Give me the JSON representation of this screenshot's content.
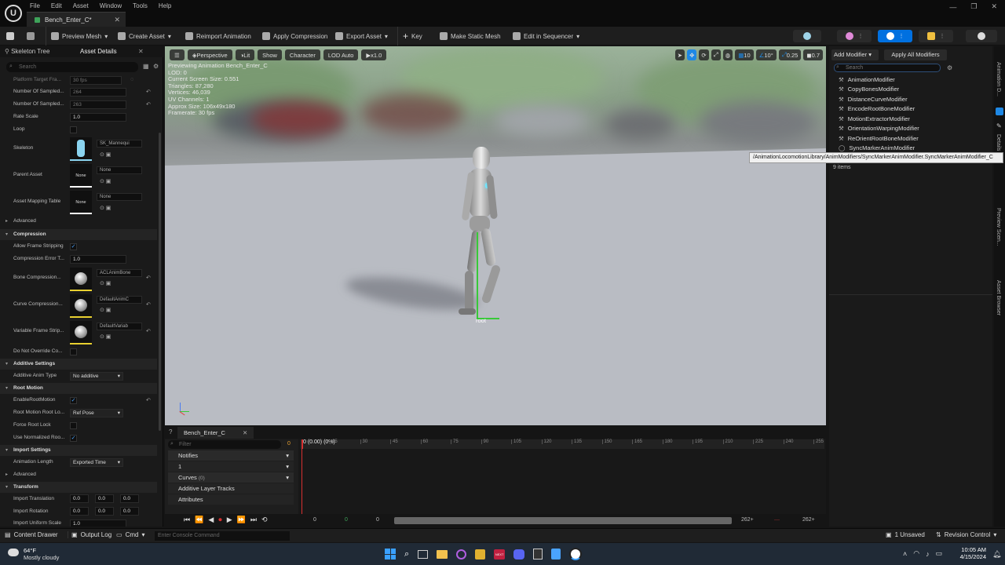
{
  "menu": [
    "File",
    "Edit",
    "Asset",
    "Window",
    "Tools",
    "Help"
  ],
  "tab_title": "Bench_Enter_C*",
  "toolbar": {
    "preview_mesh": "Preview Mesh",
    "create_asset": "Create Asset",
    "reimport": "Reimport Animation",
    "apply_compression": "Apply Compression",
    "export_asset": "Export Asset",
    "key": "Key",
    "make_static_mesh": "Make Static Mesh",
    "edit_in_sequencer": "Edit in Sequencer"
  },
  "left_panel": {
    "tabs": [
      "Skeleton Tree",
      "Asset Details"
    ],
    "search_placeholder": "Search",
    "platform_target": {
      "label": "Platform Target Fra...",
      "value": "30 fps"
    },
    "props": [
      {
        "label": "Number Of Sampled...",
        "value": "264"
      },
      {
        "label": "Number Of Sampled...",
        "value": "263"
      },
      {
        "label": "Rate Scale",
        "value": "1.0"
      }
    ],
    "loop_label": "Loop",
    "skeleton": {
      "label": "Skeleton",
      "asset": "SK_Mannequi"
    },
    "parent_asset": {
      "label": "Parent Asset",
      "thumb": "None",
      "asset": "None"
    },
    "asset_mapping": {
      "label": "Asset Mapping Table",
      "thumb": "None",
      "asset": "None"
    },
    "advanced": "Advanced",
    "compression_cat": "Compression",
    "allow_frame_stripping": "Allow Frame Stripping",
    "compression_error": {
      "label": "Compression Error T...",
      "value": "1.0"
    },
    "bone_compression": {
      "label": "Bone Compression...",
      "asset": "ACLAnimBone"
    },
    "curve_compression": {
      "label": "Curve Compression...",
      "asset": "DefaultAnimC"
    },
    "variable_frame": {
      "label": "Variable Frame Strip...",
      "asset": "DefaultVariab"
    },
    "do_not_override": "Do Not Override Co...",
    "additive_cat": "Additive Settings",
    "additive_anim_type": {
      "label": "Additive Anim Type",
      "value": "No additive"
    },
    "root_motion_cat": "Root Motion",
    "enable_root_motion": "EnableRootMotion",
    "root_motion_lock": {
      "label": "Root Motion Root Lo...",
      "value": "Ref Pose"
    },
    "force_root_lock": "Force Root Lock",
    "use_normalized": "Use Normalized Roo...",
    "import_cat": "Import Settings",
    "animation_length": {
      "label": "Animation Length",
      "value": "Exported Time"
    },
    "advanced2": "Advanced",
    "transform_cat": "Transform",
    "import_translation": {
      "label": "Import Translation",
      "values": [
        "0.0",
        "0.0",
        "0.0"
      ]
    },
    "import_rotation": {
      "label": "Import Rotation",
      "values": [
        "0.0",
        "0.0",
        "0.0"
      ]
    },
    "import_uniform_scale": {
      "label": "Import Uniform Scale",
      "value": "1.0"
    }
  },
  "viewport": {
    "perspective": "Perspective",
    "lit": "Lit",
    "show": "Show",
    "character": "Character",
    "lod": "LOD Auto",
    "speed": "x1.0",
    "info": [
      "Previewing Animation Bench_Enter_C",
      "LOD: 0",
      "Current Screen Size: 0.551",
      "Triangles: 87,280",
      "Vertices: 46,039",
      "UV Channels: 1",
      "Approx Size: 106x49x180",
      "Framerate: 30 fps"
    ],
    "grid_size": "10",
    "rot_snap": "10°",
    "scale_snap": "0.25",
    "cam_speed": "0.7",
    "root_label": "root"
  },
  "timeline": {
    "tab": "Bench_Enter_C",
    "filter_placeholder": "Filter",
    "frame": "0",
    "time_readout": "0 (0.00) (0%)",
    "ruler_ticks": [
      "15",
      "30",
      "45",
      "60",
      "75",
      "90",
      "105",
      "120",
      "135",
      "150",
      "165",
      "180",
      "195",
      "210",
      "225",
      "240",
      "255"
    ],
    "notifies": "Notifies",
    "notify_row": "1",
    "curves": "Curves",
    "curves_count": "(0)",
    "additive_layer": "Additive Layer Tracks",
    "attributes": "Attributes",
    "start_a": "0",
    "start_b": "0",
    "start_c": "0",
    "end_a": "262+",
    "end_b": "262+"
  },
  "right_panel": {
    "add_modifier": "Add Modifier",
    "apply_all": "Apply All Modifiers",
    "search_placeholder": "Search",
    "modifiers": [
      "AnimationModifier",
      "CopyBonesModifier",
      "DistanceCurveModifier",
      "EncodeRootBoneModifier",
      "MotionExtractorModifier",
      "OrientationWarpingModifier",
      "ReOrientRootBoneModifier",
      "SyncMarkerAnimModifier"
    ],
    "items_count": "9 items",
    "tooltip": "/AnimationLocomotionLibrary/AnimModifiers/SyncMarkerAnimModifier.SyncMarkerAnimModifier_C",
    "side_tabs": [
      "Animation D...",
      "Details",
      "Preview Scen...",
      "Asset Browser"
    ]
  },
  "statusbar": {
    "content_drawer": "Content Drawer",
    "output_log": "Output Log",
    "cmd": "Cmd",
    "console_placeholder": "Enter Console Command",
    "unsaved": "1 Unsaved",
    "revision": "Revision Control"
  },
  "taskbar": {
    "temp": "64°F",
    "weather": "Mostly cloudy",
    "time": "10:05 AM",
    "date": "4/15/2024"
  },
  "colors": {
    "accent": "#0070e0",
    "selected_blue": "#1e88e5",
    "root_green": "#38c938"
  }
}
